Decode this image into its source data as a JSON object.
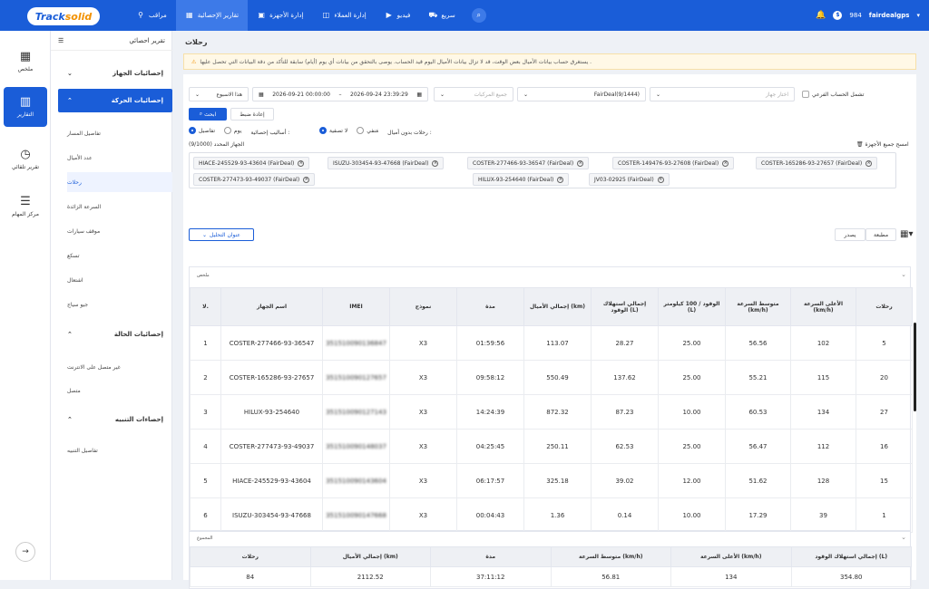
{
  "topbar": {
    "logo_a": "Track",
    "logo_b": "solid",
    "nav": [
      {
        "label": "مراقب",
        "icon": "⚲"
      },
      {
        "label": "تقارير الإحصائية",
        "icon": "▦"
      },
      {
        "label": "إدارة الأجهزة",
        "icon": "▣"
      },
      {
        "label": "إدارة العملاء",
        "icon": "◫"
      },
      {
        "label": "فيديو",
        "icon": "▶"
      },
      {
        "label": "سريع",
        "icon": "⛟"
      }
    ],
    "balance": "984",
    "user": "fairdealgps"
  },
  "sidebar": [
    {
      "label": "ملخص",
      "icon": "▦"
    },
    {
      "label": "التقارير",
      "icon": "▥"
    },
    {
      "label": "تقرير تلقائي",
      "icon": "◷"
    },
    {
      "label": "مركز المهام",
      "icon": "☰"
    }
  ],
  "subside": {
    "title": "تقرير احصائي",
    "sections": [
      {
        "label": "إحصائيات الجهاز"
      },
      {
        "label": "إحصائيات الحركة"
      },
      {
        "label": "إحصائيات الحالة"
      },
      {
        "label": "إحصاءات التنبيه"
      }
    ],
    "items": [
      "تفاصيل المسار",
      "عدد الأميال",
      "رحلات",
      "السرعة الزائدة",
      "موقف سيارات",
      "تسكع",
      "اشتعال",
      "جيو سياج",
      "غير متصل على الانترنت",
      "متصل",
      "تفاصيل التنبيه"
    ]
  },
  "page": {
    "title": "رحلات",
    "notice": "يستغرق حساب بيانات الأميال بعض الوقت، قد لا تزال بيانات الأميال اليوم قيد الحساب. يوصى بالتحقق من بيانات أي يوم (أيام) سابقة للتأكد من دقة البيانات التي تحصل عليها ."
  },
  "filters": {
    "period": "هذا الاسبوع",
    "date_from": "2026-09-21 00:00:00",
    "date_to": "2026-09-24 23:39:29",
    "to_sep": "–",
    "all_vehicles": "جميع المركبات",
    "account": "FairDeal(9/1444)",
    "device_placeholder": "اختار جهاز",
    "sub_account_label": "تشمل الحساب الفرعي",
    "search_btn": "ابحث",
    "reset_btn": "إعادة ضبط",
    "stat_method_label": "أساليب إحصائية :",
    "stat_opts": [
      "تفاصيل",
      "يوم"
    ],
    "filter_label": "رحلات بدون أميال :",
    "filter_opts": [
      "لا تصفية",
      "مَنفي"
    ],
    "selected_label": "الجهاز المحدد (9/1000)",
    "clear_all": "امسح جميع الأجهزة"
  },
  "chips": [
    "HIACE-245529-93-43604 (FairDeal)",
    "ISUZU-303454-93-47668 (FairDeal)",
    "COSTER-277466-93-36547 (FairDeal)",
    "COSTER-149476-93-27608 (FairDeal)",
    "COSTER-165286-93-27657 (FairDeal)",
    "COSTER-277473-93-49037 (FairDeal)",
    "HILUX-93-254640 (FairDeal)",
    "JV03-02925 (FairDeal)"
  ],
  "toolbar": {
    "address_btn": "عنوان التحليل",
    "print": "مطبعة",
    "export": "يصدر"
  },
  "table": {
    "summary_label": "ملخص",
    "headers": [
      "لا.",
      "اسم الجهاز",
      "IMEI",
      "نموذج",
      "مدة",
      "إجمالي الأميال (km)",
      "إجمالي استهلاك الوقود (L)",
      "الوقود / 100 كيلومتر (L)",
      "متوسط السرعة (km/h)",
      "الأعلى السرعة (km/h)",
      "رحلات"
    ],
    "rows": [
      [
        "1",
        "COSTER-277466-93-36547",
        "351510090136847",
        "X3",
        "01:59:56",
        "113.07",
        "28.27",
        "25.00",
        "56.56",
        "102",
        "5"
      ],
      [
        "2",
        "COSTER-165286-93-27657",
        "351510090127657",
        "X3",
        "09:58:12",
        "550.49",
        "137.62",
        "25.00",
        "55.21",
        "115",
        "20"
      ],
      [
        "3",
        "HILUX-93-254640",
        "351510090127143",
        "X3",
        "14:24:39",
        "872.32",
        "87.23",
        "10.00",
        "60.53",
        "134",
        "27"
      ],
      [
        "4",
        "COSTER-277473-93-49037",
        "351510090148037",
        "X3",
        "04:25:45",
        "250.11",
        "62.53",
        "25.00",
        "56.47",
        "112",
        "16"
      ],
      [
        "5",
        "HIACE-245529-93-43604",
        "351510090143604",
        "X3",
        "06:17:57",
        "325.18",
        "39.02",
        "12.00",
        "51.62",
        "128",
        "15"
      ],
      [
        "6",
        "ISUZU-303454-93-47668",
        "351510090147668",
        "X3",
        "00:04:43",
        "1.36",
        "0.14",
        "10.00",
        "17.29",
        "39",
        "1"
      ]
    ]
  },
  "total": {
    "label": "المجموع",
    "headers": [
      "رحلات",
      "إجمالي الأميال (km)",
      "مدة",
      "متوسط السرعة (km/h)",
      "الأعلى السرعة (km/h)",
      "إجمالي استهلاك الوقود (L)"
    ],
    "values": [
      "84",
      "2112.52",
      "37:11:12",
      "56.81",
      "134",
      "354.80"
    ]
  }
}
